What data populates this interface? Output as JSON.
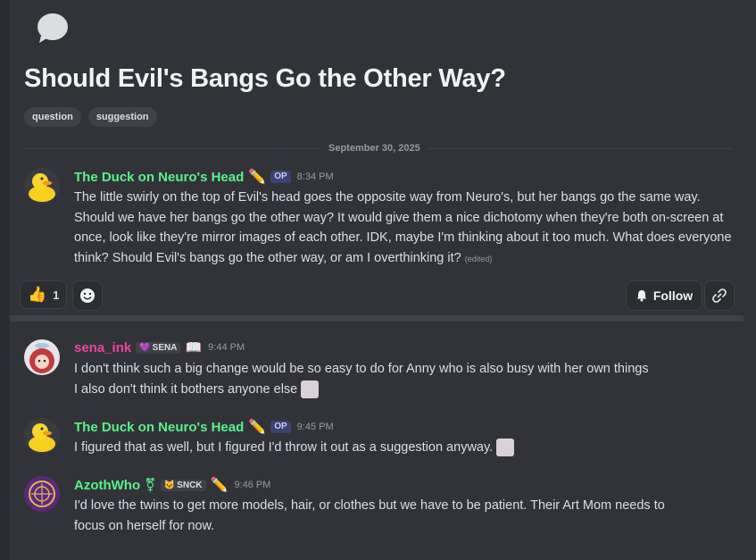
{
  "thread": {
    "title": "Should Evil's Bangs Go the Other Way?",
    "tags": [
      "question",
      "suggestion"
    ],
    "date_divider": "September 30, 2025"
  },
  "original_post": {
    "author": "The Duck on Neuro's Head",
    "author_color": "#57f287",
    "badge": "OP",
    "time": "8:34 PM",
    "body": "The little swirly on the top of Evil's head goes the opposite way from Neuro's, but her bangs go the same way. Should we have her bangs go the other way? It would give them a nice dichotomy when they're both on-screen at once, look like they're mirror images of each other. IDK, maybe I'm thinking about it too much. What does everyone think? Should Evil's bangs go the other way, or am I overthinking it?",
    "edited": "(edited)"
  },
  "reactions": {
    "thumbs_count": "1",
    "thumbs_icon": "thumbs-up-emoji",
    "add_icon": "smiley-add-icon"
  },
  "actions": {
    "follow_label": "Follow",
    "follow_icon": "bell-icon",
    "link_icon": "link-icon"
  },
  "replies": [
    {
      "author": "sena_ink",
      "author_color": "#eb459e",
      "role_tag": "SENA",
      "time": "9:44 PM",
      "lines": [
        "I don't think such a big change would be so easy to do for Anny who is also busy with her own things",
        "I also don't think it bothers anyone else"
      ]
    },
    {
      "author": "The Duck on Neuro's Head",
      "author_color": "#57f287",
      "badge": "OP",
      "time": "9:45 PM",
      "lines": [
        "I figured that as well, but I figured I'd throw it out as a suggestion anyway."
      ]
    },
    {
      "author": "AzothWho",
      "author_color": "#57f287",
      "role_tag": "SNCK",
      "time": "9:46 PM",
      "lines": [
        "I'd love the twins to get more models, hair, or clothes but we have to be patient.  Their Art Mom needs to",
        "focus on herself for now."
      ]
    }
  ]
}
